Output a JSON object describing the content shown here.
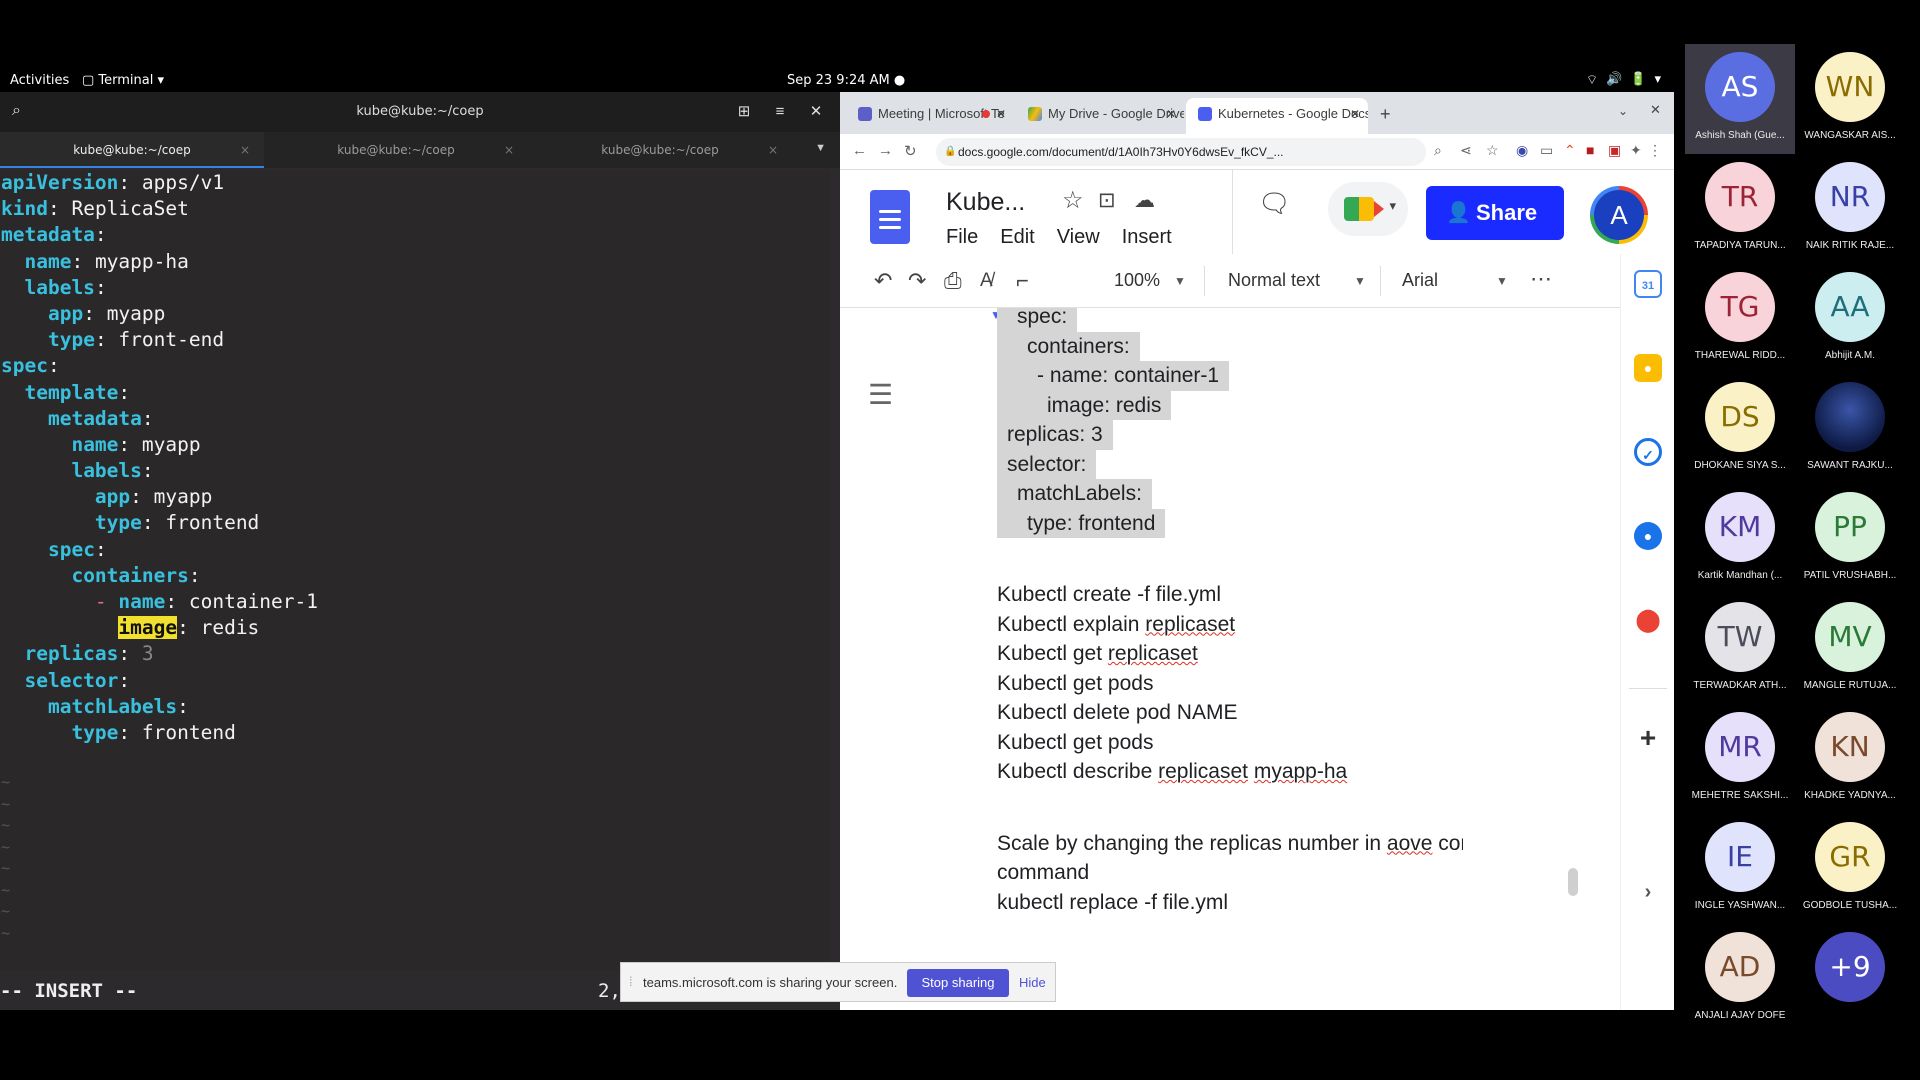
{
  "topbar": {
    "activities": "Activities",
    "app_menu": "Terminal ▾",
    "clock": "Sep 23  9:24 AM ●",
    "tray": [
      "wifi-icon",
      "volume-icon",
      "battery-icon",
      "power-menu-icon"
    ],
    "tray_glyphs": [
      "⌔",
      "🔊",
      "🔋",
      "▾"
    ]
  },
  "terminal": {
    "title": "kube@kube:~/coep",
    "tabs": [
      "kube@kube:~/coep",
      "kube@kube:~/coep",
      "kube@kube:~/coep"
    ],
    "lines": [
      {
        "key": "apiVersion",
        "val": " apps/v1",
        "indent": ""
      },
      {
        "key": "kind",
        "val": " ReplicaSet",
        "indent": ""
      },
      {
        "key": "metadata",
        "val": "",
        "indent": ""
      },
      {
        "key": "name",
        "val": " myapp-ha",
        "indent": "  "
      },
      {
        "key": "labels",
        "val": "",
        "indent": "  "
      },
      {
        "key": "app",
        "val": " myapp",
        "indent": "    "
      },
      {
        "key": "type",
        "val": " front-end",
        "indent": "    "
      },
      {
        "key": "spec",
        "val": "",
        "indent": ""
      },
      {
        "key": "template",
        "val": "",
        "indent": "  "
      },
      {
        "key": "metadata",
        "val": "",
        "indent": "    "
      },
      {
        "key": "name",
        "val": " myapp",
        "indent": "      "
      },
      {
        "key": "labels",
        "val": "",
        "indent": "      "
      },
      {
        "key": "app",
        "val": " myapp",
        "indent": "        "
      },
      {
        "key": "type",
        "val": " frontend",
        "indent": "        "
      },
      {
        "key": "spec",
        "val": "",
        "indent": "    "
      },
      {
        "key": "containers",
        "val": "",
        "indent": "      "
      },
      {
        "key": "name",
        "val": " container-1",
        "indent": "        - "
      },
      {
        "key": "image",
        "val": " redis",
        "indent": "          ",
        "highlight": true
      },
      {
        "key": "replicas",
        "val": " 3",
        "indent": "  ",
        "dim": true
      },
      {
        "key": "selector",
        "val": "",
        "indent": "  "
      },
      {
        "key": "matchLabels",
        "val": "",
        "indent": "    "
      },
      {
        "key": "type",
        "val": " frontend",
        "indent": "      "
      }
    ],
    "tilde_count": 8,
    "mode": "-- INSERT --",
    "cursor_pos": "2,"
  },
  "browser": {
    "tabs": [
      {
        "label": "Meeting | Microsoft Te",
        "color": "#5b5fc7"
      },
      {
        "label": "My Drive - Google Drive",
        "color": "#34a853"
      },
      {
        "label": "Kubernetes - Google Docs",
        "color": "#4a5ef0"
      }
    ],
    "new_tab": "+",
    "url": "docs.google.com/document/d/1A0Ih73Hv0Y6dwsEv_fkCV_..."
  },
  "docs": {
    "title": "Kube...",
    "menu": [
      "File",
      "Edit",
      "View",
      "Insert"
    ],
    "share_label": "Share",
    "account_initial": "A",
    "zoom": "100%",
    "style": "Normal text",
    "font": "Arial",
    "accent": "#1a2bff",
    "yaml_lines": [
      {
        "text": "spec:",
        "indent": 1
      },
      {
        "text": "containers:",
        "indent": 2
      },
      {
        "text": "- name: container-1",
        "indent": 3
      },
      {
        "text": "image: redis",
        "indent": 4
      },
      {
        "text": "replicas: 3",
        "indent": 0
      },
      {
        "text": "selector:",
        "indent": 0
      },
      {
        "text": "matchLabels:",
        "indent": 1
      },
      {
        "text": "type: frontend",
        "indent": 2
      }
    ],
    "commands": [
      {
        "pre": "Kubectl create -f file.yml",
        "err": "",
        "post": ""
      },
      {
        "pre": "Kubectl explain ",
        "err": "replicaset",
        "post": ""
      },
      {
        "pre": "Kubectl get ",
        "err": "replicaset",
        "post": ""
      },
      {
        "pre": "Kubectl get pods",
        "err": "",
        "post": ""
      },
      {
        "pre": "Kubectl delete pod NAME",
        "err": "",
        "post": ""
      },
      {
        "pre": "Kubectl get pods",
        "err": "",
        "post": ""
      },
      {
        "pre": "Kubectl describe ",
        "err": "replicaset",
        "post": " ",
        "err2": "myapp-ha"
      }
    ],
    "scale_line1_pre": "Scale by changing the replicas number in ",
    "scale_line1_err": "aove",
    "scale_line1_post": " config and",
    "scale_line2": "command",
    "scale_line3": "kubectl replace -f file.yml"
  },
  "sharing": {
    "message": "teams.microsoft.com is sharing your screen.",
    "stop": "Stop sharing",
    "hide": "Hide"
  },
  "participants": [
    {
      "initials": "AS",
      "name": "Ashish Shah (Gue...",
      "bg": "#5b6ee1",
      "fg": "#ffffff"
    },
    {
      "initials": "WN",
      "name": "WANGASKAR AIS...",
      "bg": "#fbf1c7",
      "fg": "#8a6d00"
    },
    {
      "initials": "TR",
      "name": "TAPADIYA TARUN...",
      "bg": "#f8d3d9",
      "fg": "#9b2335"
    },
    {
      "initials": "NR",
      "name": "NAIK RITIK RAJE...",
      "bg": "#dfe3fb",
      "fg": "#3840a8"
    },
    {
      "initials": "TG",
      "name": "THAREWAL RIDD...",
      "bg": "#f8d3d9",
      "fg": "#9b2335"
    },
    {
      "initials": "AA",
      "name": "Abhijit A.M.",
      "bg": "#cdeef0",
      "fg": "#1d6f7a"
    },
    {
      "initials": "DS",
      "name": "DHOKANE SIYA S...",
      "bg": "#fbf1c7",
      "fg": "#8a6d00"
    },
    {
      "initials": "",
      "name": "SAWANT RAJKU...",
      "bg": "#1b2a66",
      "fg": "#ffffff"
    },
    {
      "initials": "KM",
      "name": "Kartik Mandhan (...",
      "bg": "#e6e0fa",
      "fg": "#4f3a9e"
    },
    {
      "initials": "PP",
      "name": "PATIL VRUSHABH...",
      "bg": "#d9f2dc",
      "fg": "#2c7a37"
    },
    {
      "initials": "TW",
      "name": "TERWADKAR ATH...",
      "bg": "#e3e3e8",
      "fg": "#4c4c5a"
    },
    {
      "initials": "MV",
      "name": "MANGLE RUTUJA...",
      "bg": "#d9f2dc",
      "fg": "#2c7a37"
    },
    {
      "initials": "MR",
      "name": "MEHETRE SAKSHI...",
      "bg": "#e6e0fa",
      "fg": "#4f3a9e"
    },
    {
      "initials": "KN",
      "name": "KHADKE YADNYA...",
      "bg": "#f0e2d8",
      "fg": "#7a4a2c"
    },
    {
      "initials": "IE",
      "name": "INGLE YASHWAN...",
      "bg": "#dfe3fb",
      "fg": "#3840a8"
    },
    {
      "initials": "GR",
      "name": "GODBOLE TUSHA...",
      "bg": "#fbf1c7",
      "fg": "#8a6d00"
    },
    {
      "initials": "AD",
      "name": "ANJALI AJAY DOFE",
      "bg": "#f0e2d8",
      "fg": "#7a4a2c"
    },
    {
      "initials": "+9",
      "name": "",
      "bg": "#4b4cc2",
      "fg": "#ffffff"
    }
  ]
}
